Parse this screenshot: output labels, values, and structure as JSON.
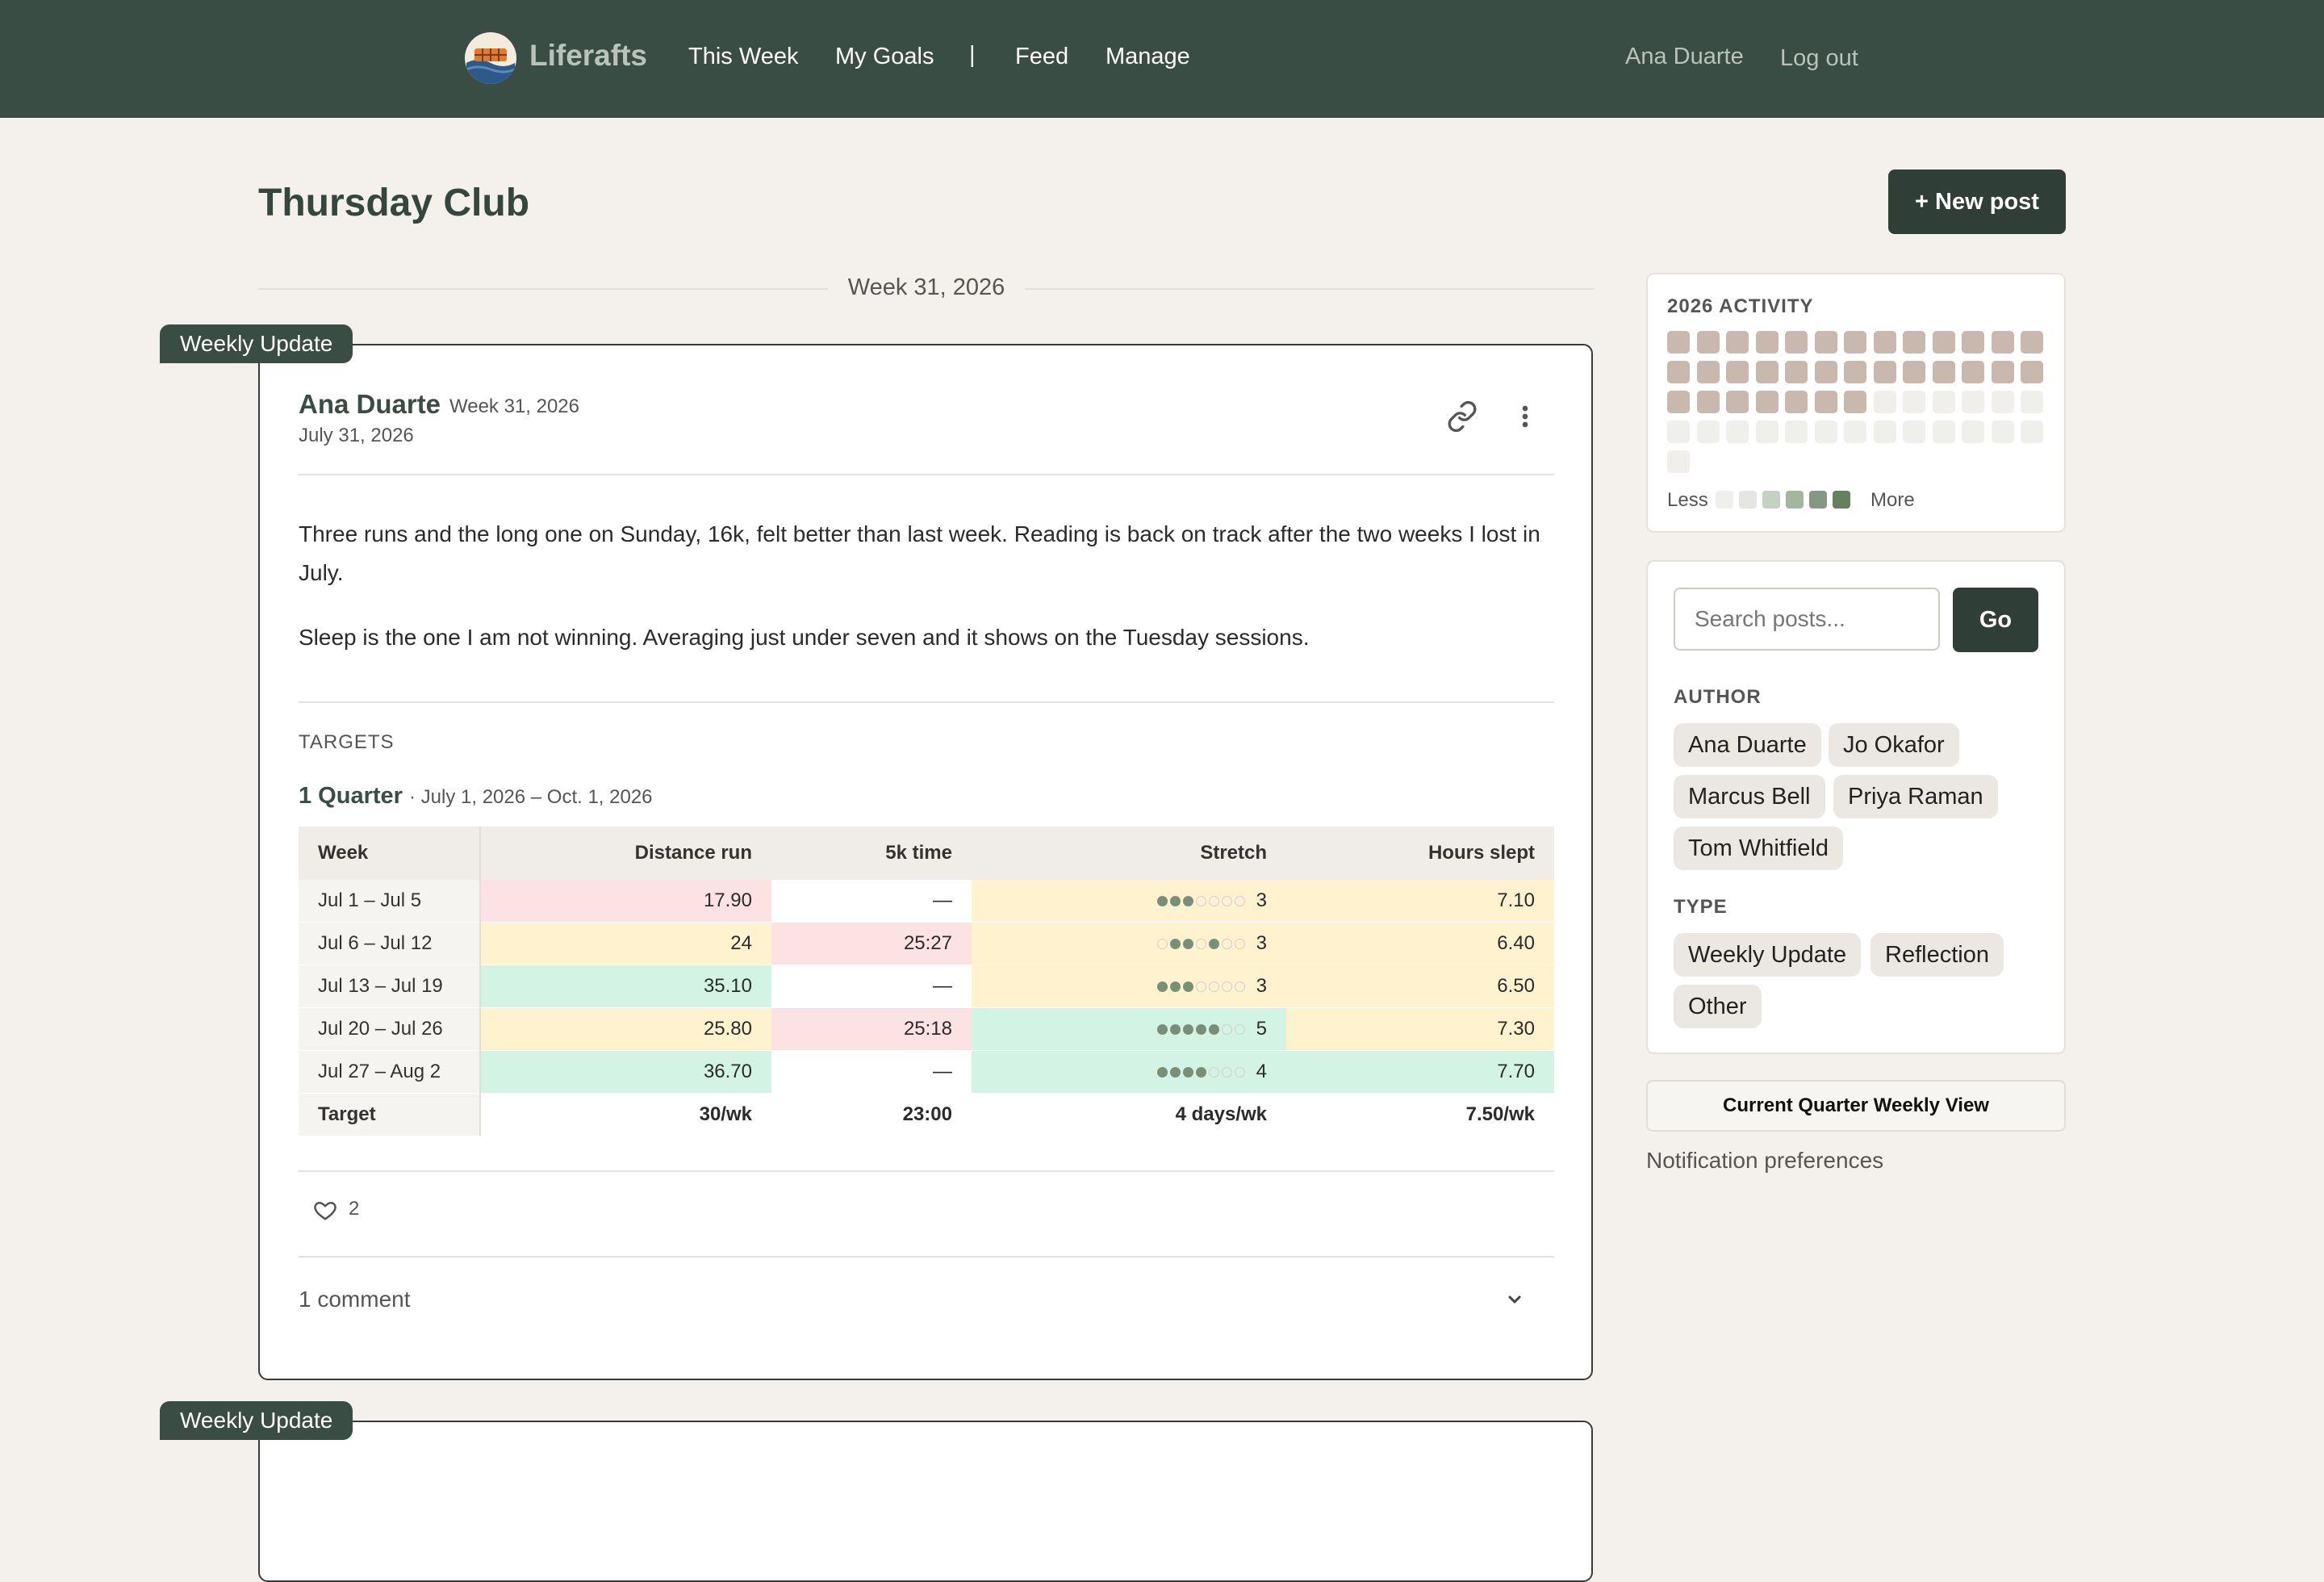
{
  "nav": {
    "brand": "Liferafts",
    "links": [
      "This Week",
      "My Goals",
      "Feed",
      "Manage"
    ],
    "separator": "|",
    "user": "Ana Duarte",
    "logout": "Log out"
  },
  "page": {
    "title": "Thursday Club",
    "new_post": "+ New post",
    "week_divider": "Week 31, 2026"
  },
  "post": {
    "tag": "Weekly Update",
    "author": "Ana Duarte",
    "week": "Week 31, 2026",
    "date": "July 31, 2026",
    "paragraphs": [
      "Three runs and the long one on Sunday, 16k, felt better than last week. Reading is back on track after the two weeks I lost in July.",
      "Sleep is the one I am not winning. Averaging just under seven and it shows on the Tuesday sessions."
    ],
    "targets_heading": "TARGETS",
    "quarter_title": "1 Quarter",
    "quarter_range": "· July 1, 2026 – Oct. 1, 2026",
    "table": {
      "headers": [
        "Week",
        "Distance run",
        "5k time",
        "Stretch",
        "Hours slept"
      ],
      "rows": [
        {
          "week": "Jul 1 – Jul 5",
          "distance": "17.90",
          "five_k": "—",
          "stretch": "3",
          "stretch_days": [
            1,
            1,
            1,
            0,
            0,
            0,
            0
          ],
          "sleep": "7.10",
          "colors": [
            "red",
            "wht",
            "yel",
            "yel"
          ]
        },
        {
          "week": "Jul 6 – Jul 12",
          "distance": "24",
          "five_k": "25:27",
          "stretch": "3",
          "stretch_days": [
            0,
            1,
            1,
            0,
            1,
            0,
            0
          ],
          "sleep": "6.40",
          "colors": [
            "yel",
            "red",
            "yel",
            "yel"
          ]
        },
        {
          "week": "Jul 13 – Jul 19",
          "distance": "35.10",
          "five_k": "—",
          "stretch": "3",
          "stretch_days": [
            1,
            1,
            1,
            0,
            0,
            0,
            0
          ],
          "sleep": "6.50",
          "colors": [
            "grn",
            "wht",
            "yel",
            "yel"
          ]
        },
        {
          "week": "Jul 20 – Jul 26",
          "distance": "25.80",
          "five_k": "25:18",
          "stretch": "5",
          "stretch_days": [
            1,
            1,
            1,
            1,
            1,
            0,
            0
          ],
          "sleep": "7.30",
          "colors": [
            "yel",
            "red",
            "grn",
            "yel"
          ]
        },
        {
          "week": "Jul 27 – Aug 2",
          "distance": "36.70",
          "five_k": "—",
          "stretch": "4",
          "stretch_days": [
            1,
            1,
            1,
            1,
            0,
            0,
            0
          ],
          "sleep": "7.70",
          "colors": [
            "grn",
            "wht",
            "grn",
            "grn"
          ]
        }
      ],
      "target": {
        "label": "Target",
        "distance": "30/wk",
        "five_k": "23:00",
        "stretch": "4 days/wk",
        "sleep": "7.50/wk"
      }
    },
    "likes": "2",
    "comments": "1 comment"
  },
  "next_post": {
    "tag": "Weekly Update"
  },
  "sidebar": {
    "activity_title": "2026 ACTIVITY",
    "activity_levels": [
      2,
      2,
      2,
      2,
      2,
      2,
      2,
      2,
      2,
      2,
      2,
      2,
      2,
      2,
      2,
      2,
      2,
      2,
      2,
      2,
      2,
      2,
      2,
      2,
      2,
      2,
      2,
      2,
      2,
      2,
      2,
      2,
      2,
      0,
      0,
      0,
      0,
      0,
      0,
      0,
      0,
      0,
      0,
      0,
      0,
      0,
      0,
      0,
      0,
      0,
      0,
      0,
      0
    ],
    "legend_less": "Less",
    "legend_more": "More",
    "legend_colors": [
      "#f1efec",
      "#e4e7e1",
      "#c5d1c2",
      "#a4b69f",
      "#84997f",
      "#66805f"
    ],
    "filled_color": "#c8b8ad",
    "empty_color": "#f1efec",
    "search_placeholder": "Search posts...",
    "go": "Go",
    "author_heading": "AUTHOR",
    "authors": [
      "Ana Duarte",
      "Jo Okafor",
      "Marcus Bell",
      "Priya Raman",
      "Tom Whitfield"
    ],
    "type_heading": "TYPE",
    "types": [
      "Weekly Update",
      "Reflection",
      "Other"
    ],
    "quarter_view": "Current Quarter Weekly View",
    "notifications": "Notification preferences"
  }
}
